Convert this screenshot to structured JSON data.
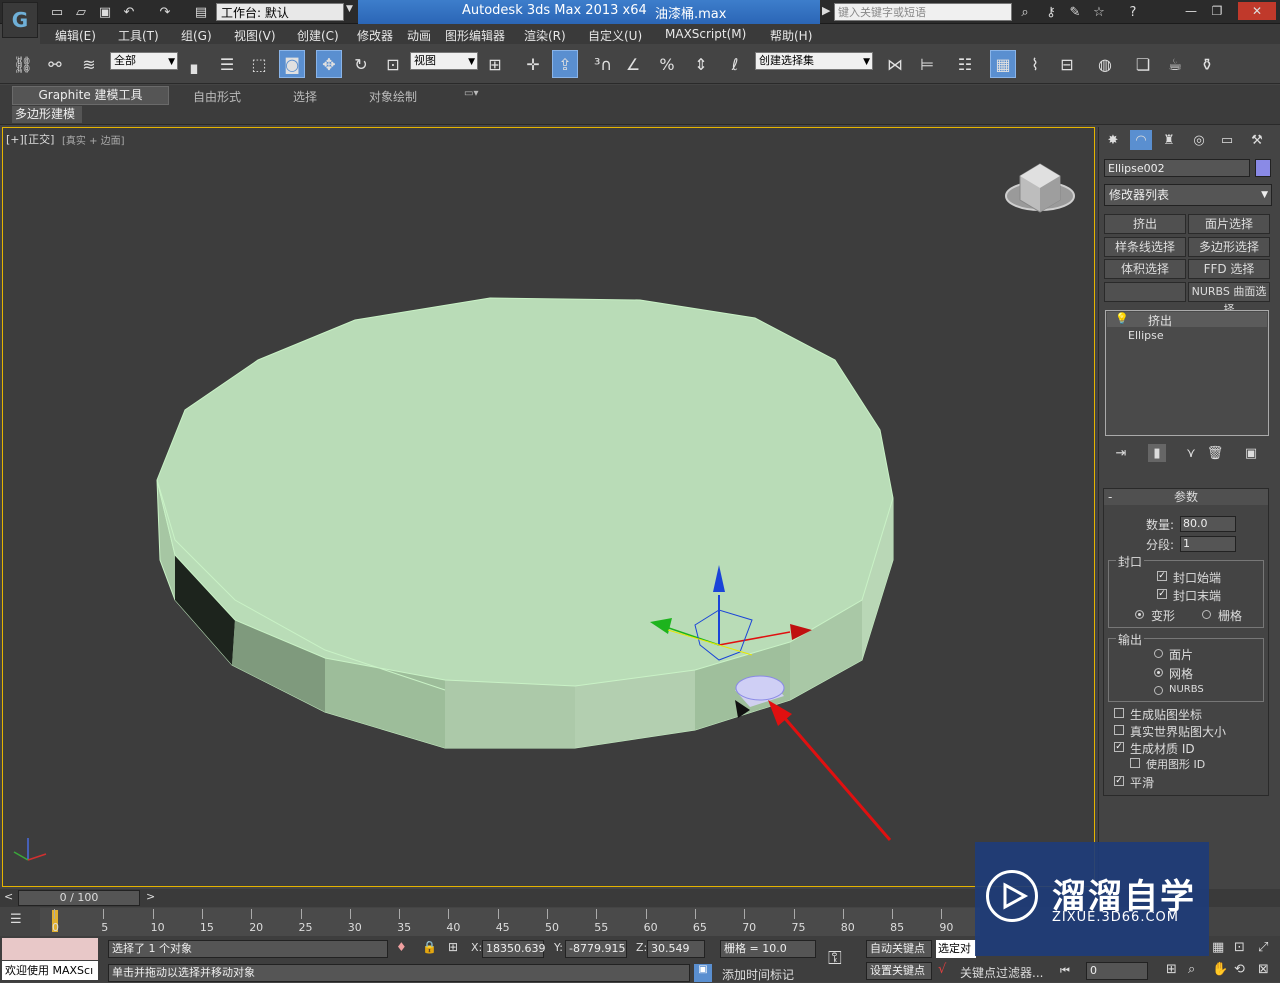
{
  "titlebar": {
    "workspace_label": "工作台: 默认",
    "app_title": "Autodesk 3ds Max  2013 x64",
    "file_name": "油漆桶.max",
    "search_placeholder": "键入关键字或短语"
  },
  "menu": [
    "编辑(E)",
    "工具(T)",
    "组(G)",
    "视图(V)",
    "创建(C)",
    "修改器",
    "动画",
    "图形编辑器",
    "渲染(R)",
    "自定义(U)",
    "MAXScript(M)",
    "帮助(H)"
  ],
  "toolbar": {
    "selection_filter": "全部",
    "ref_coord": "视图",
    "named_selection": "创建选择集"
  },
  "ribbon": {
    "tabs": [
      "Graphite 建模工具",
      "自由形式",
      "选择",
      "对象绘制"
    ],
    "sub_tab": "多边形建模"
  },
  "viewport": {
    "label": "[+][正交]",
    "shading": "[真实 + 边面]"
  },
  "command_panel": {
    "object_name": "Ellipse002",
    "modifier_list": "修改器列表",
    "modifier_buttons": [
      "挤出",
      "面片选择",
      "样条线选择",
      "多边形选择",
      "体积选择",
      "FFD 选择",
      "",
      "NURBS 曲面选择"
    ],
    "stack": [
      "挤出",
      "Ellipse"
    ],
    "params": {
      "title": "参数",
      "amount_label": "数量:",
      "amount": "80.0",
      "segments_label": "分段:",
      "segments": "1",
      "capping_group": "封口",
      "cap_start": "封口始端",
      "cap_end": "封口末端",
      "morph": "变形",
      "grid": "栅格",
      "output_group": "输出",
      "patch": "面片",
      "mesh": "网格",
      "nurbs": "NURBS",
      "gen_map": "生成贴图坐标",
      "real_world": "真实世界贴图大小",
      "gen_mat": "生成材质 ID",
      "use_shape": "使用图形 ID",
      "smooth": "平滑"
    }
  },
  "timeline": {
    "slider": "0 / 100",
    "ticks": [
      "0",
      "5",
      "10",
      "15",
      "20",
      "25",
      "30",
      "35",
      "40",
      "45",
      "50",
      "55",
      "60",
      "65",
      "70",
      "75",
      "80",
      "85",
      "90"
    ]
  },
  "status": {
    "maxscript": "欢迎使用 MAXScı",
    "selected": "选择了 1 个对象",
    "prompt": "单击并拖动以选择并移动对象",
    "x_label": "X:",
    "x": "18350.639",
    "y_label": "Y:",
    "y": "-8779.915",
    "z_label": "Z:",
    "z": "30.549",
    "grid": "栅格 = 10.0",
    "auto_key": "自动关键点",
    "selected_obj": "选定对",
    "set_key": "设置关键点",
    "key_filters": "关键点过滤器...",
    "add_time_tag": "添加时间标记",
    "frame": "0"
  },
  "watermark": {
    "title": "溜溜自学",
    "sub": "ZIXUE.3D66.COM"
  },
  "colors": {
    "viewport_bg": "#3d3d3d",
    "object": "#b8dcb6",
    "selection_edge": "#c9f2c6",
    "active_border": "#e5b400",
    "arrow": "#e01010"
  }
}
